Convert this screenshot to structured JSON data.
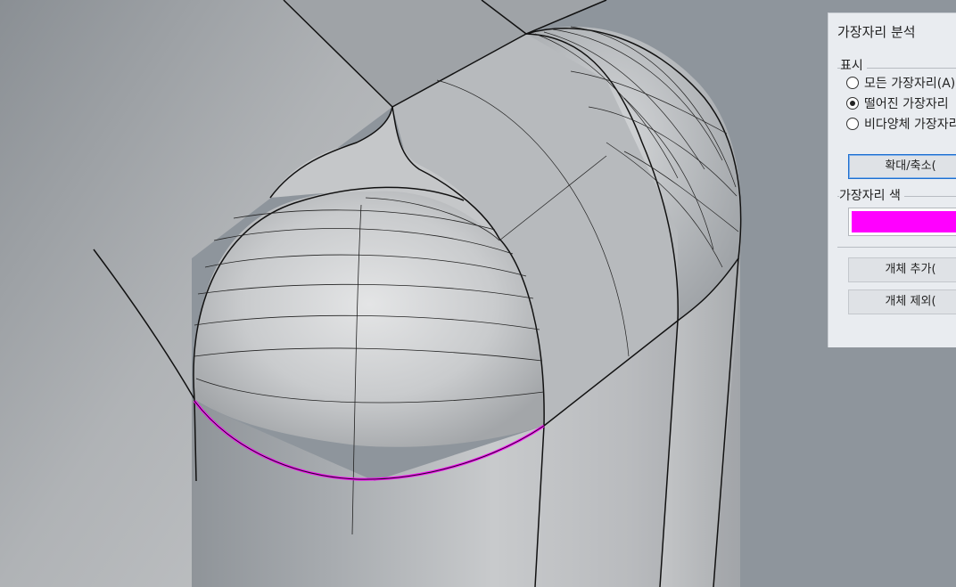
{
  "dialog": {
    "title": "가장자리 분석",
    "display_group": {
      "label": "표시",
      "options": [
        {
          "label": "모든 가장자리(A)",
          "checked": false
        },
        {
          "label": "떨어진 가장자리",
          "checked": true
        },
        {
          "label": "비다양체 가장자리",
          "checked": false
        }
      ]
    },
    "zoom_button": "확대/축소(",
    "color_group": {
      "label": "가장자리 색",
      "color": "#ff00ff"
    },
    "add_objects_button": "개체 추가(",
    "remove_objects_button": "개체 제외("
  },
  "colors": {
    "viewport_background": "#8e959c",
    "edge_highlight": "#ff00ff",
    "panel_background": "#e9ecf0"
  },
  "icons": [
    "radio-unchecked",
    "radio-checked"
  ]
}
